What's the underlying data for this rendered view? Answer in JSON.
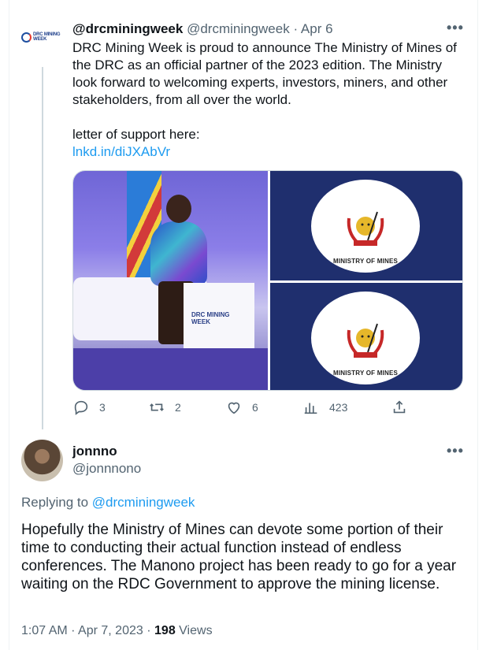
{
  "quoted_tweet": {
    "logo_text_line1": "DRC MINING",
    "logo_text_line2": "WEEK",
    "display_name": "@drcminingweek",
    "handle": "@drcminingweek",
    "separator": "·",
    "date": "Apr 6",
    "text_paragraph1": "DRC Mining Week is proud to announce The Ministry of Mines of the DRC as an official partner of the 2023 edition. The Ministry look forward to welcoming experts, investors, miners, and other stakeholders, from all over the world.",
    "text_paragraph2": "letter of support here:",
    "link": "lnkd.in/diJXAbVr",
    "media": {
      "podium_text_line1": "DRC MINING",
      "podium_text_line2": "WEEK",
      "seal_caption": "MINISTRY OF MINES",
      "seal_caption_2": "MINISTRY OF MINES"
    },
    "actions": {
      "replies": "3",
      "retweets": "2",
      "likes": "6",
      "views": "423"
    }
  },
  "main_tweet": {
    "display_name": "jonnno",
    "handle": "@jonnnono",
    "replying_prefix": "Replying to",
    "replying_to": "@drcminingweek",
    "text": "Hopefully the Ministry of Mines can devote some portion of their time to conducting their actual function instead of endless conferences. The Manono project has been ready to go for a year waiting on the RDC Government to approve the mining license.",
    "time": "1:07 AM",
    "separator": "·",
    "date": "Apr 7, 2023",
    "separator2": "·",
    "views_count": "198",
    "views_label": "Views"
  },
  "icons": [
    "reply-icon",
    "retweet-icon",
    "like-icon",
    "views-icon",
    "share-icon",
    "more-icon"
  ],
  "colors": {
    "link": "#1d9bf0",
    "muted": "#536471",
    "text": "#0f1419",
    "thread_line": "#cfd9de"
  }
}
